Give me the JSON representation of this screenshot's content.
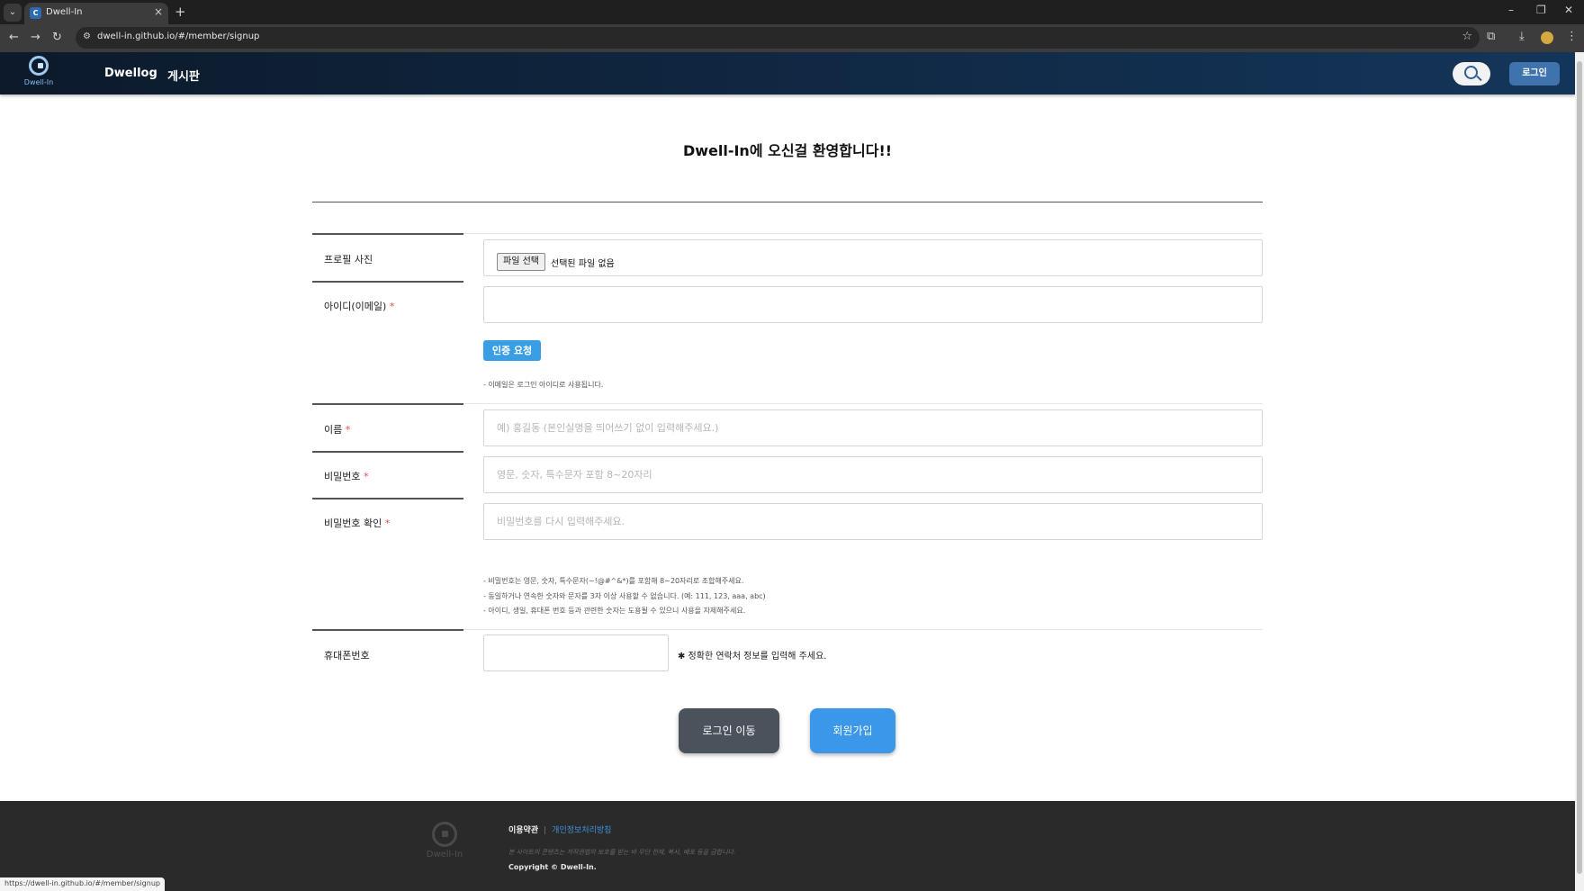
{
  "browser": {
    "tab_title": "Dwell-In",
    "tab_close": "×",
    "new_tab": "+",
    "url": "dwell-in.github.io/#/member/signup",
    "status_url": "https://dwell-in.github.io/#/member/signup"
  },
  "header": {
    "logo_text": "Dwell-In",
    "nav": [
      "Dwellog",
      "게시판"
    ],
    "login_label": "로그인"
  },
  "page": {
    "title": "Dwell-In에 오신걸 환영합니다!!"
  },
  "form": {
    "profile_label": "프로필 사진",
    "file_button": "파일 선택",
    "file_none": "선택된 파일 없음",
    "email_label": "아이디(이메일)",
    "required_mark": "*",
    "auth_button": "인증 요청",
    "email_help": "- 이메일은 로그인 아이디로 사용됩니다.",
    "name_label": "이름",
    "name_placeholder": "예) 홍길동 (본인실명을 띄어쓰기 없이 입력해주세요.)",
    "password_label": "비밀번호",
    "password_placeholder": "영문, 숫자, 특수문자 포함 8~20자리",
    "password_confirm_label": "비밀번호 확인",
    "password_confirm_placeholder": "비밀번호를 다시 입력해주세요.",
    "password_help": [
      "- 비밀번호는 영문, 숫자, 특수문자(~!@#^&*)를 포함해 8~20자리로 조합해주세요.",
      "- 동일하거나 연속한 숫자와 문자를 3자 이상 사용할 수 없습니다. (예: 111, 123, aaa, abc)",
      "- 아이디, 생일, 휴대폰 번호 등과 관련한 숫자는 도용될 수 있으니 사용을 자제해주세요."
    ],
    "phone_label": "휴대폰번호",
    "phone_note": "✱ 정확한 연락처 정보를 입력해 주세요."
  },
  "actions": {
    "login_move": "로그인 이동",
    "signup": "회원가입"
  },
  "footer": {
    "logo_text": "Dwell-In",
    "terms": "이용약관",
    "separator": "|",
    "privacy": "개인정보처리방침",
    "notice": "본 사이트의 콘텐츠는 저작권법의 보호를 받는 바 무단 전재, 복사, 배포 등을 금합니다.",
    "copyright": "Copyright © Dwell-In."
  },
  "colors": {
    "header_dark": "#0c1a2b",
    "accent_blue": "#3a97e9",
    "required_red": "#e24b4b",
    "footer_bg": "#2a2a2a"
  },
  "icons": [
    "back-icon",
    "forward-icon",
    "reload-icon",
    "site-info-icon",
    "bookmark-star-icon",
    "extensions-icon",
    "download-icon",
    "menu-icon",
    "search-icon"
  ]
}
